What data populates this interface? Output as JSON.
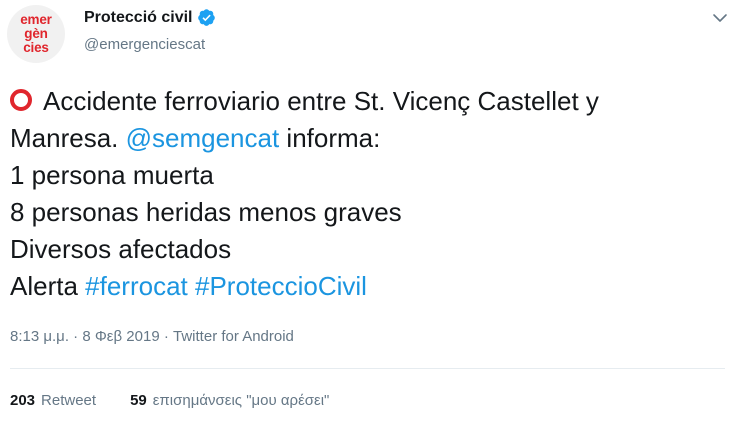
{
  "account": {
    "avatar_lines": [
      "emer",
      "gèn",
      "cies"
    ],
    "display_name": "Protecció civil",
    "handle": "@emergenciescat",
    "verified": true
  },
  "tweet": {
    "line1": "Accidente ferroviario entre St. Vicenç Castellet y",
    "line2_pre": "Manresa. ",
    "mention": "@semgencat",
    "line2_post": " informa:",
    "line3": "1 persona muerta",
    "line4": "8 personas heridas menos graves",
    "line5": "Diversos afectados",
    "line6_pre": "Alerta ",
    "hashtag1": "#ferrocat",
    "hashtag_sep": " ",
    "hashtag2": "#ProteccioCivil"
  },
  "meta": {
    "time": "8:13 μ.μ.",
    "sep": " · ",
    "date": "8 Φεβ 2019",
    "source": "Twitter for Android"
  },
  "stats": {
    "retweets_count": "203",
    "retweets_label": "Retweet",
    "likes_count": "59",
    "likes_label": "επισημάνσεις \"μου αρέσει\""
  },
  "icons": {
    "verified": "verified-badge-icon",
    "menu": "chevron-down-icon",
    "alert": "red-circle-emoji-icon"
  },
  "colors": {
    "link": "#1b95e0",
    "brand_red": "#e0262d",
    "secondary_text": "#657786",
    "verified": "#1da1f2"
  }
}
